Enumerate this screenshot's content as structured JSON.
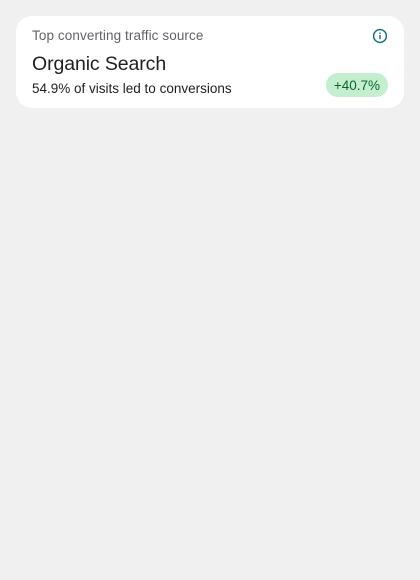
{
  "card": {
    "title": "Top converting traffic source",
    "info_icon": "info-icon",
    "source_name": "Organic Search",
    "detail": "54.9% of visits led to conversions",
    "change": "+40.7%"
  },
  "colors": {
    "background": "#f0f0f0",
    "card": "#ffffff",
    "info_icon": "#0b6b73",
    "badge_bg": "#c4eed0",
    "badge_text": "#0d652d"
  }
}
